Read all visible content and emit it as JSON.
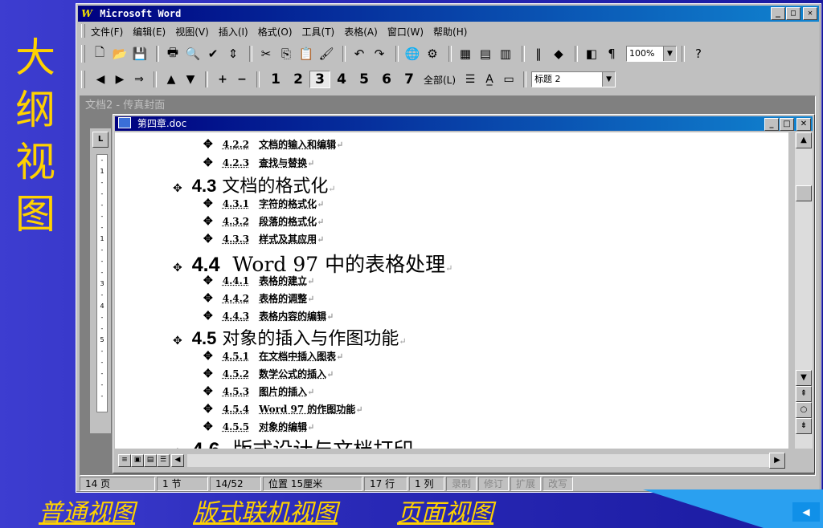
{
  "slide": {
    "title_chars": [
      "大",
      "纲",
      "视",
      "图"
    ],
    "links": [
      "普通视图",
      "版式联机视图",
      "页面视图"
    ],
    "accent_color": "#ffd200"
  },
  "word": {
    "title": "Microsoft Word",
    "menu": [
      "文件(F)",
      "编辑(E)",
      "视图(V)",
      "插入(I)",
      "格式(O)",
      "工具(T)",
      "表格(A)",
      "窗口(W)",
      "帮助(H)"
    ],
    "zoom": "100%",
    "style": "标题 2",
    "outline_levels": [
      "1",
      "2",
      "3",
      "4",
      "5",
      "6",
      "7"
    ],
    "all_label": "全部(L)",
    "background_doc_title": "文档2 - 传真封面",
    "doc_title": "第四章.doc"
  },
  "outline": [
    {
      "level": 3,
      "num": "4.2.2",
      "text": "文档的输入和编辑"
    },
    {
      "level": 3,
      "num": "4.2.3",
      "text": "查找与替换"
    },
    {
      "level": 2,
      "num": "4.3",
      "text": "文档的格式化"
    },
    {
      "level": 3,
      "num": "4.3.1",
      "text": "字符的格式化"
    },
    {
      "level": 3,
      "num": "4.3.2",
      "text": "段落的格式化"
    },
    {
      "level": 3,
      "num": "4.3.3",
      "text": "样式及其应用"
    },
    {
      "level": 2,
      "num": "4.4",
      "text": "Word 97 中的表格处理"
    },
    {
      "level": 3,
      "num": "4.4.1",
      "text": "表格的建立"
    },
    {
      "level": 3,
      "num": "4.4.2",
      "text": "表格的调整"
    },
    {
      "level": 3,
      "num": "4.4.3",
      "text": "表格内容的编辑"
    },
    {
      "level": 2,
      "num": "4.5",
      "text": "对象的插入与作图功能"
    },
    {
      "level": 3,
      "num": "4.5.1",
      "text": "在文档中插入图表"
    },
    {
      "level": 3,
      "num": "4.5.2",
      "text": "数学公式的插入"
    },
    {
      "level": 3,
      "num": "4.5.3",
      "text": "图片的插入"
    },
    {
      "level": 3,
      "num": "4.5.4",
      "text": "Word 97 的作图功能"
    },
    {
      "level": 3,
      "num": "4.5.5",
      "text": "对象的编辑"
    },
    {
      "level": 2,
      "num": "4.6",
      "text": "版式设计与文档打印"
    }
  ],
  "status": {
    "page": "14 页",
    "section": "1 节",
    "page_of": "14/52",
    "position": "位置 15厘米",
    "line": "17 行",
    "col": "1 列",
    "rec": "录制",
    "trk": "修订",
    "ext": "扩展",
    "ovr": "改写"
  }
}
